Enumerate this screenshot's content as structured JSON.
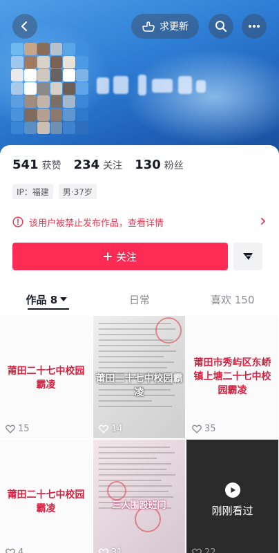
{
  "header": {
    "update_label": "求更新"
  },
  "profile": {
    "stats": [
      {
        "num": "541",
        "label": "获赞"
      },
      {
        "num": "234",
        "label": "关注"
      },
      {
        "num": "130",
        "label": "粉丝"
      }
    ],
    "tags": [
      "IP：福建",
      "男·37岁"
    ],
    "ban_notice": "该用户被禁止发布作品，查看详情",
    "follow_label": "关注"
  },
  "tabs": [
    {
      "label": "作品 8"
    },
    {
      "label": "日常"
    },
    {
      "label": "喜欢 150"
    }
  ],
  "videos": [
    {
      "title": "莆田二十七中校园霸凌",
      "likes": "15"
    },
    {
      "title": "莆田二十七中校园霸凌",
      "likes": "14"
    },
    {
      "title": "莆田市秀屿区东峤镇上塘二十七中校园霸凌",
      "likes": "35"
    },
    {
      "title": "莆田二十七中校园霸凌",
      "likes": "4"
    },
    {
      "title": "三人围殴班门",
      "likes": "31"
    },
    {
      "title": "",
      "likes": "22",
      "overlay": "刚刚看过"
    }
  ],
  "colors": {
    "accent": "#fe2c55",
    "warning": "#e83a52",
    "title_red": "#d62240"
  }
}
